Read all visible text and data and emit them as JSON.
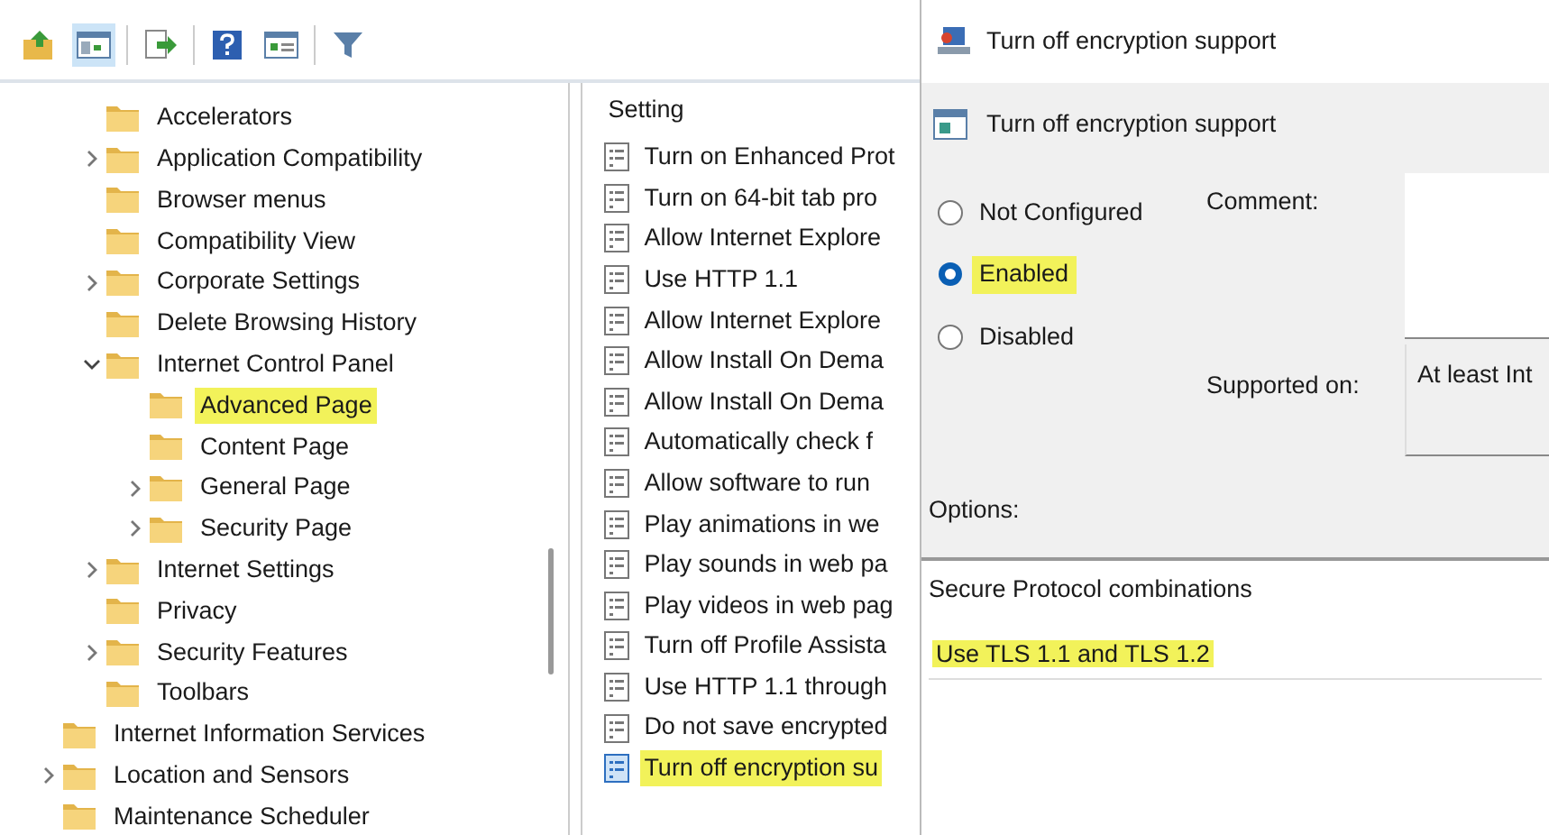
{
  "toolbar": {
    "buttons": [
      {
        "kind": "up"
      },
      {
        "kind": "pane",
        "selected": true
      },
      {
        "kind": "export"
      },
      {
        "kind": "help"
      },
      {
        "kind": "view"
      },
      {
        "kind": "filter"
      }
    ]
  },
  "tree": {
    "partial_branch": [
      {
        "label": "Accelerators",
        "selected": false,
        "highlighted": false
      },
      {
        "label": "Application Compatibility",
        "expanded": false,
        "selected": false,
        "highlighted": false
      },
      {
        "label": "Browser menus",
        "selected": false,
        "highlighted": false
      },
      {
        "label": "Compatibility View",
        "selected": false,
        "highlighted": false
      },
      {
        "label": "Corporate Settings",
        "expanded": false,
        "selected": false,
        "highlighted": false
      },
      {
        "label": "Delete Browsing History",
        "selected": false,
        "highlighted": false
      },
      {
        "label": "Internet Control Panel",
        "expanded": true,
        "selected": false,
        "highlighted": false,
        "children": [
          {
            "label": "Advanced Page",
            "selected": true,
            "highlighted": true
          },
          {
            "label": "Content Page",
            "selected": false,
            "highlighted": false
          },
          {
            "label": "General Page",
            "expanded": false,
            "selected": false,
            "highlighted": false
          },
          {
            "label": "Security Page",
            "expanded": false,
            "selected": false,
            "highlighted": false
          }
        ]
      },
      {
        "label": "Internet Settings",
        "expanded": false,
        "selected": false,
        "highlighted": false
      },
      {
        "label": "Privacy",
        "selected": false,
        "highlighted": false
      },
      {
        "label": "Security Features",
        "expanded": false,
        "selected": false,
        "highlighted": false
      },
      {
        "label": "Toolbars",
        "selected": false,
        "highlighted": false
      }
    ],
    "items": [
      {
        "label": "Internet Information Services",
        "selected": false,
        "highlighted": false
      },
      {
        "label": "Location and Sensors",
        "expanded": false,
        "selected": false,
        "highlighted": false
      },
      {
        "label": "Maintenance Scheduler",
        "selected": false,
        "highlighted": false
      }
    ]
  },
  "settings": {
    "column": "Setting",
    "rows": [
      {
        "label": "Turn on Enhanced Prot",
        "selected": false,
        "highlighted": false
      },
      {
        "label": "Turn on 64-bit tab pro",
        "selected": false,
        "highlighted": false
      },
      {
        "label": "Allow Internet Explore",
        "selected": false,
        "highlighted": false
      },
      {
        "label": "Use HTTP 1.1",
        "selected": false,
        "highlighted": false
      },
      {
        "label": "Allow Internet Explore",
        "selected": false,
        "highlighted": false
      },
      {
        "label": "Allow Install On Dema",
        "selected": false,
        "highlighted": false
      },
      {
        "label": "Allow Install On Dema",
        "selected": false,
        "highlighted": false
      },
      {
        "label": "Automatically check f",
        "selected": false,
        "highlighted": false
      },
      {
        "label": "Allow software to run",
        "selected": false,
        "highlighted": false
      },
      {
        "label": "Play animations in we",
        "selected": false,
        "highlighted": false
      },
      {
        "label": "Play sounds in web pa",
        "selected": false,
        "highlighted": false
      },
      {
        "label": "Play videos in web pag",
        "selected": false,
        "highlighted": false
      },
      {
        "label": "Turn off Profile Assista",
        "selected": false,
        "highlighted": false
      },
      {
        "label": "Use HTTP 1.1 through",
        "selected": false,
        "highlighted": false
      },
      {
        "label": "Do not save encrypted",
        "selected": false,
        "highlighted": false
      },
      {
        "label": "Turn off encryption su",
        "selected": true,
        "highlighted": true
      }
    ]
  },
  "dialog": {
    "title": "Turn off encryption support",
    "heading": "Turn off encryption support",
    "options": [
      {
        "label": "Not Configured",
        "selected": false,
        "highlighted": false
      },
      {
        "label": "Enabled",
        "selected": true,
        "highlighted": true
      },
      {
        "label": "Disabled",
        "selected": false,
        "highlighted": false
      }
    ],
    "comment_label": "Comment:",
    "supported_label": "Supported on:",
    "supported_value": "At least Int",
    "options_label": "Options:",
    "option_title": "Secure Protocol combinations",
    "option_value": "Use TLS 1.1 and TLS 1.2",
    "option_highlighted": true
  }
}
